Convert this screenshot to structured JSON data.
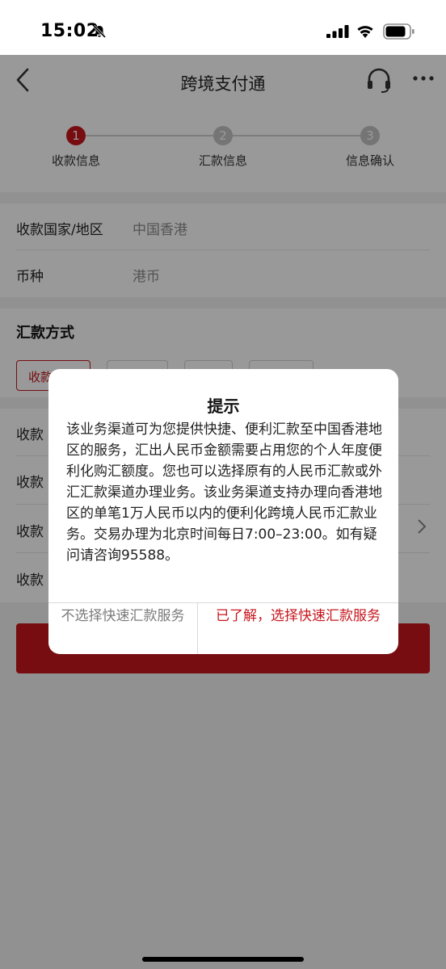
{
  "status_bar": {
    "time": "15:02",
    "icons": [
      "bell-off-icon",
      "cellular-signal-icon",
      "wifi-icon",
      "battery-icon"
    ]
  },
  "navbar": {
    "title": "跨境支付通",
    "icons": [
      "back-icon",
      "headset-icon",
      "more-icon"
    ]
  },
  "stepper": {
    "steps": [
      {
        "num": "1",
        "label": "收款信息",
        "active": true
      },
      {
        "num": "2",
        "label": "汇款信息",
        "active": false
      },
      {
        "num": "3",
        "label": "信息确认",
        "active": false
      }
    ]
  },
  "form": {
    "rows": [
      {
        "label": "收款国家/地区",
        "value": "中国香港"
      },
      {
        "label": "币种",
        "value": "港币"
      }
    ]
  },
  "method": {
    "title": "汇款方式",
    "selected_option": "收款"
  },
  "form2": {
    "rows": [
      {
        "label": "收款"
      },
      {
        "label": "收款"
      },
      {
        "label": "收款"
      },
      {
        "label": "收款"
      }
    ]
  },
  "dialog": {
    "title": "提示",
    "body": "该业务渠道可为您提供快捷、便利汇款至中国香港地区的服务，汇出人民币金额需要占用您的个人年度便利化购汇额度。您也可以选择原有的人民币汇款或外汇汇款渠道办理业务。该业务渠道支持办理向香港地区的单笔1万人民币以内的便利化跨境人民币汇款业务。交易办理为北京时间每日7:00–23:00。如有疑问请咨询95588。",
    "cancel_label": "不选择快速汇款服务",
    "confirm_label": "已了解，选择快速汇款服务"
  },
  "colors": {
    "accent": "#c6161d",
    "inactive_step": "#c4c4c4",
    "overlay": "rgba(0,0,0,0.40)"
  }
}
